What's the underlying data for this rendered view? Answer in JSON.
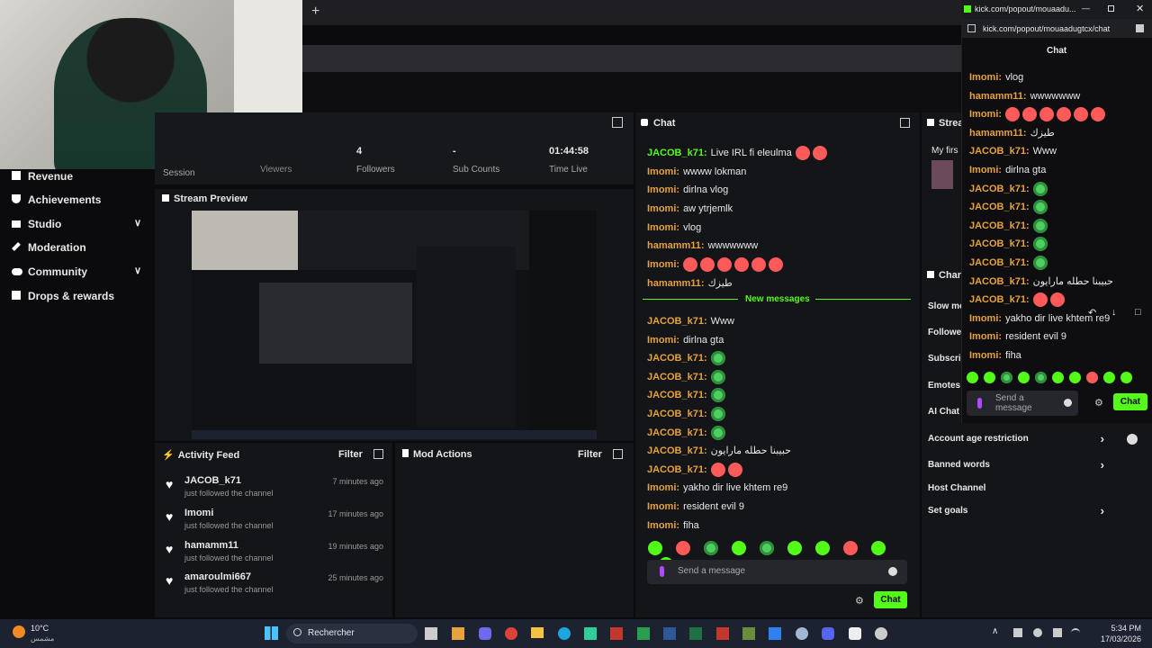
{
  "browser": {
    "new_tab_plus": "+",
    "popout_tab_title": "kick.com/popout/mouaadu...",
    "popout_url": "kick.com/popout/mouaadugtcx/chat"
  },
  "stats": [
    {
      "value": "",
      "label": "Session"
    },
    {
      "value": "",
      "label": "Viewers"
    },
    {
      "value": "4",
      "label": "Followers"
    },
    {
      "value": "-",
      "label": "Sub Counts"
    },
    {
      "value": "01:44:58",
      "label": "Time Live"
    }
  ],
  "sidebar": {
    "items": [
      {
        "label": "Revenue"
      },
      {
        "label": "Achievements"
      },
      {
        "label": "Studio"
      },
      {
        "label": "Moderation"
      },
      {
        "label": "Community"
      },
      {
        "label": "Drops & rewards"
      }
    ]
  },
  "stream_preview": {
    "title": "Stream Preview"
  },
  "activity_feed": {
    "title": "Activity Feed",
    "filter": "Filter",
    "items": [
      {
        "user": "JACOB_k71",
        "action": "just followed the channel",
        "time": "7 minutes ago"
      },
      {
        "user": "Imomi",
        "action": "just followed the channel",
        "time": "17 minutes ago"
      },
      {
        "user": "hamamm11",
        "action": "just followed the channel",
        "time": "19 minutes ago"
      },
      {
        "user": "amaroulmi667",
        "action": "just followed the channel",
        "time": "25 minutes ago"
      }
    ]
  },
  "mod_actions": {
    "title": "Mod Actions",
    "filter": "Filter"
  },
  "dashboard_chat": {
    "title": "Chat",
    "new_messages": "New messages",
    "messages_before": [
      {
        "user": "JACOB_k71:",
        "text": "Live IRL fi eleulma",
        "emotes": 2,
        "color": "#53fc18"
      },
      {
        "user": "Imomi:",
        "text": "wwww lokman",
        "emotes": 0,
        "color": "#e6a23c"
      },
      {
        "user": "Imomi:",
        "text": "dirlna vlog",
        "emotes": 0,
        "color": "#e6a23c"
      },
      {
        "user": "Imomi:",
        "text": "aw ytrjemlk",
        "emotes": 0,
        "color": "#e6a23c"
      },
      {
        "user": "Imomi:",
        "text": "vlog",
        "emotes": 0,
        "color": "#e6a23c"
      },
      {
        "user": "hamamm11:",
        "text": "wwwwwww",
        "emotes": 0,
        "color": "#e6a23c"
      },
      {
        "user": "Imomi:",
        "text": "",
        "emotes": 6,
        "color": "#e6a23c"
      },
      {
        "user": "hamamm11:",
        "text": "طيزك",
        "emotes": 0,
        "color": "#e6a23c"
      }
    ],
    "messages_after": [
      {
        "user": "JACOB_k71:",
        "text": "Www",
        "emotes": 0,
        "color": "#e6a23c"
      },
      {
        "user": "Imomi:",
        "text": "dirlna gta",
        "emotes": 0,
        "color": "#e6a23c"
      },
      {
        "user": "JACOB_k71:",
        "text": "",
        "emotes": 1,
        "color": "#e6a23c"
      },
      {
        "user": "JACOB_k71:",
        "text": "",
        "emotes": 1,
        "color": "#e6a23c"
      },
      {
        "user": "JACOB_k71:",
        "text": "",
        "emotes": 1,
        "color": "#e6a23c"
      },
      {
        "user": "JACOB_k71:",
        "text": "",
        "emotes": 1,
        "color": "#e6a23c"
      },
      {
        "user": "JACOB_k71:",
        "text": "",
        "emotes": 1,
        "color": "#e6a23c"
      },
      {
        "user": "JACOB_k71:",
        "text": "حبيبنا حطله مارايون",
        "emotes": 0,
        "color": "#e6a23c"
      },
      {
        "user": "JACOB_k71:",
        "text": "",
        "emotes": 2,
        "color": "#e6a23c"
      },
      {
        "user": "Imomi:",
        "text": "yakho dir live khtem re9",
        "emotes": 0,
        "color": "#e6a23c"
      },
      {
        "user": "Imomi:",
        "text": "resident evil 9",
        "emotes": 0,
        "color": "#e6a23c"
      },
      {
        "user": "Imomi:",
        "text": "fiha",
        "emotes": 0,
        "color": "#e6a23c"
      }
    ],
    "placeholder": "Send a message",
    "chat_button": "Chat"
  },
  "settings_panel": {
    "title": "Strea",
    "my_first": "My firs",
    "chat_settings": "Chan",
    "rows": [
      {
        "label": "Slow mo"
      },
      {
        "label": "Followe"
      },
      {
        "label": "Subscri"
      },
      {
        "label": "Emotes"
      },
      {
        "label": "AI Chat"
      }
    ],
    "links": [
      {
        "label": "Account age restriction"
      },
      {
        "label": "Banned words"
      },
      {
        "label": "Host Channel"
      },
      {
        "label": "Set goals"
      }
    ]
  },
  "popout_chat": {
    "header": "Chat",
    "messages": [
      {
        "user": "Imomi:",
        "text": "vlog",
        "emotes": 0
      },
      {
        "user": "hamamm11:",
        "text": "wwwwwww",
        "emotes": 0
      },
      {
        "user": "Imomi:",
        "text": "",
        "emotes": 6
      },
      {
        "user": "hamamm11:",
        "text": "طيزك",
        "emotes": 0
      },
      {
        "user": "JACOB_k71:",
        "text": "Www",
        "emotes": 0
      },
      {
        "user": "Imomi:",
        "text": "dirlna gta",
        "emotes": 0
      },
      {
        "user": "JACOB_k71:",
        "text": "",
        "emotes": 1
      },
      {
        "user": "JACOB_k71:",
        "text": "",
        "emotes": 1
      },
      {
        "user": "JACOB_k71:",
        "text": "",
        "emotes": 1
      },
      {
        "user": "JACOB_k71:",
        "text": "",
        "emotes": 1
      },
      {
        "user": "JACOB_k71:",
        "text": "",
        "emotes": 1
      },
      {
        "user": "JACOB_k71:",
        "text": "حبيبنا حطله مارايون",
        "emotes": 0
      },
      {
        "user": "JACOB_k71:",
        "text": "",
        "emotes": 2
      },
      {
        "user": "Imomi:",
        "text": "yakho dir live khtem re9",
        "emotes": 0
      },
      {
        "user": "Imomi:",
        "text": "resident evil 9",
        "emotes": 0
      },
      {
        "user": "Imomi:",
        "text": "fiha",
        "emotes": 0
      }
    ],
    "placeholder": "Send a message",
    "chat_button": "Chat"
  },
  "taskbar": {
    "temp": "10°C",
    "weather": "مشمس",
    "search": "Rechercher",
    "time": "5:34 PM",
    "date": "17/03/2026"
  },
  "colors": {
    "accent": "#53fc18",
    "name_orange": "#e6a23c",
    "panel": "#141518"
  }
}
